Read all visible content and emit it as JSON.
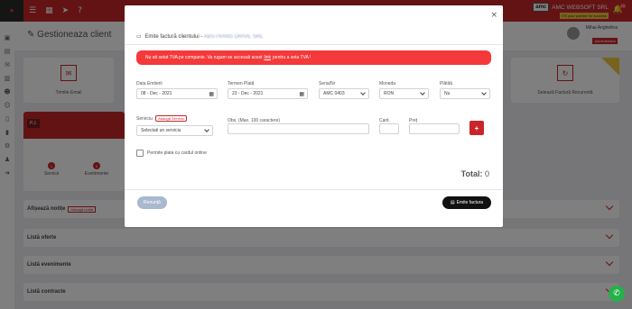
{
  "header": {
    "brand_logo": "amc",
    "brand_name": "AMC WEBSOFT SRL",
    "brand_sub": "ITS your partner for success",
    "notif_count": "15"
  },
  "page": {
    "title": "Gestioneaza client",
    "user_name": "Mihai Anghelina",
    "user_role": "Administrator"
  },
  "bg_cards": {
    "email_label": "Trimite Email",
    "recurring_label": "Setează Factură Recurentă"
  },
  "client": {
    "type_tag": "P.J.",
    "stat1_count": "1",
    "stat1_label": "Servicii",
    "stat2_count": "0",
    "stat2_label": "Evenimente"
  },
  "sections": {
    "notes": "Afișează notițe",
    "notes_add": "Adaugă notiță",
    "offers": "Listă oferte",
    "events": "Listă evenimente",
    "contracts": "Listă contracte"
  },
  "modal": {
    "title": "Emite factură clientului -",
    "client_name": "ABSTRANS DRIVE SRL",
    "close": "×",
    "alert_pre": "Nu ati setat TVA pe companie. Va rugam se accesati acest",
    "alert_link": "link",
    "alert_post": "pentru a seta TVA !",
    "fields": {
      "issue_date_label": "Data Emiterii",
      "issue_date_value": "08 - Dec - 2021",
      "due_date_label": "Termen Plată",
      "due_date_value": "23 - Dec - 2021",
      "series_label": "Seria/Nr",
      "series_value": "AMC 0403",
      "currency_label": "Moneda",
      "currency_value": "RON",
      "paid_label": "Plătită",
      "paid_value": "Nu",
      "service_label": "Serviciu",
      "add_service": "Adaugă Serviciu",
      "service_placeholder": "Selectati un serviciu",
      "obs_label": "Obs. (Max. 100 caractere)",
      "qty_label": "Cant.",
      "price_label": "Preț"
    },
    "checkbox_label": "Permite plata cu cardul online",
    "total_label": "Total:",
    "total_value": "0",
    "cancel_label": "Renunță",
    "emit_label": "Emite factura"
  }
}
